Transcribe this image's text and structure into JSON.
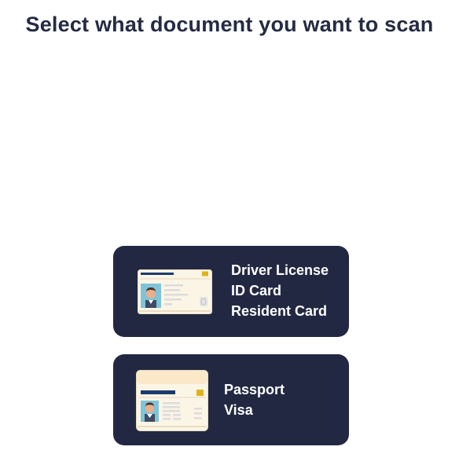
{
  "header": {
    "title": "Select what document you want to scan"
  },
  "options": [
    {
      "icon": "id-card-icon",
      "labels": [
        "Driver License",
        "ID Card",
        "Resident Card"
      ]
    },
    {
      "icon": "passport-icon",
      "labels": [
        "Passport",
        "Visa"
      ]
    }
  ],
  "colors": {
    "title": "#252b42",
    "option_background": "#232842",
    "option_text": "#ffffff",
    "card_body": "#fbf5e6",
    "card_stripe": "#1c3a6e",
    "card_chip": "#e0b21a"
  }
}
